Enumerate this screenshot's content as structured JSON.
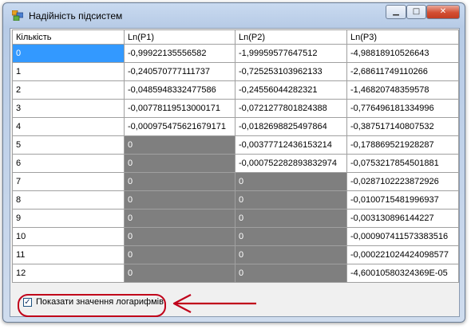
{
  "window": {
    "title": "Надійність підсистем"
  },
  "controls": {
    "minimize": "▁",
    "maximize": "□",
    "close": "✕"
  },
  "table": {
    "headers": [
      "Кількість",
      "Ln(P1)",
      "Ln(P2)",
      "Ln(P3)"
    ],
    "rows": [
      [
        "0",
        "-0,99922135556582",
        "-1,99959577647512",
        "-4,98818910526643"
      ],
      [
        "1",
        "-0,240570777111737",
        "-0,725253103962133",
        "-2,68611749110266"
      ],
      [
        "2",
        "-0,0485948332477586",
        "-0,24556044282321",
        "-1,46820748359578"
      ],
      [
        "3",
        "-0,00778119513000171",
        "-0,0721277801824388",
        "-0,776496181334996"
      ],
      [
        "4",
        "-0,000975475621679171",
        "-0,0182698825497864",
        "-0,387517140807532"
      ],
      [
        "5",
        "0",
        "-0,00377712436153214",
        "-0,178869521928287"
      ],
      [
        "6",
        "0",
        "-0,000752282893832974",
        "-0,0753217854501881"
      ],
      [
        "7",
        "0",
        "0",
        "-0,0287102223872926"
      ],
      [
        "8",
        "0",
        "0",
        "-0,0100715481996937"
      ],
      [
        "9",
        "0",
        "0",
        "-0,00313089614422​7"
      ],
      [
        "10",
        "0",
        "0",
        "-0,000907411573383516"
      ],
      [
        "11",
        "0",
        "0",
        "-0,000221024424098577"
      ],
      [
        "12",
        "0",
        "0",
        "-4,60010580324369E-05"
      ]
    ]
  },
  "show_log_checkbox": {
    "label": "Показати значення логарифмів",
    "checked": true,
    "mark": "✓"
  },
  "annotation": {
    "color": "#c0001a"
  }
}
